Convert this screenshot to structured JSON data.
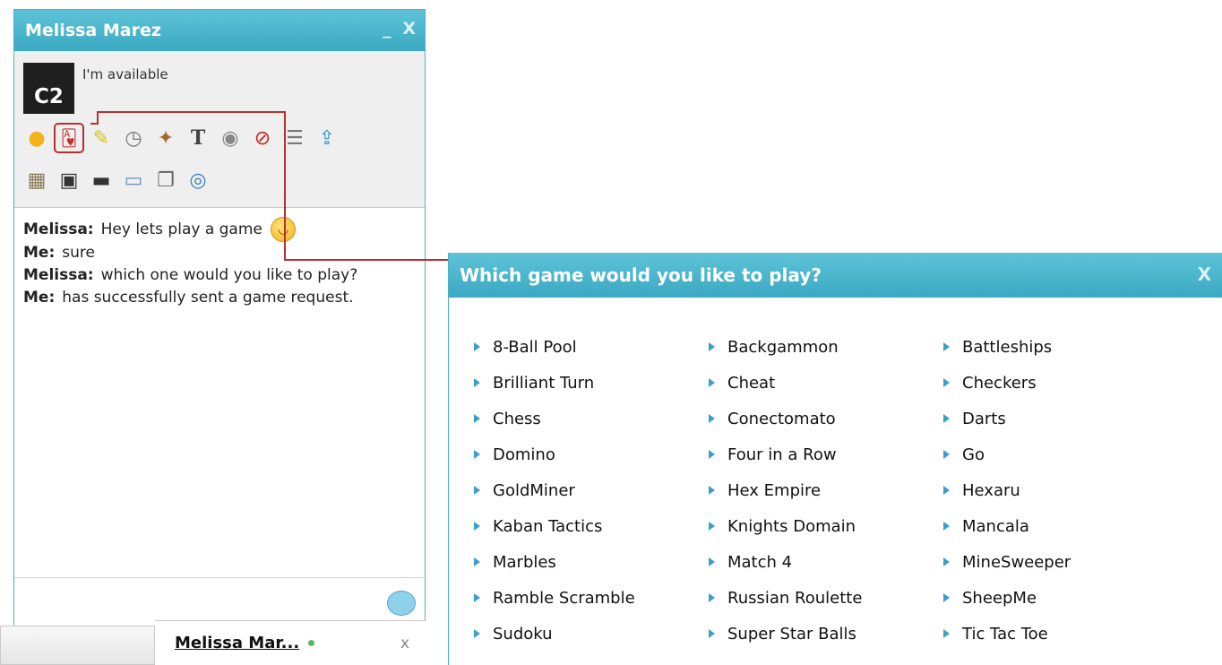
{
  "chat": {
    "title": "Melissa Marez",
    "minimize": "_",
    "close": "X",
    "avatar_text": "C2",
    "status": "I'm available",
    "toolbar_row1": [
      "emoticon-icon",
      "games-cards-icon",
      "pencil-icon",
      "clock-icon",
      "broom-icon",
      "text-format-icon",
      "webcam-icon",
      "block-icon",
      "list-icon",
      "upload-icon"
    ],
    "toolbar_row2": [
      "firewall-icon",
      "save-icon",
      "monitor-icon",
      "edit-note-icon",
      "copy-icon",
      "search-webcam-icon"
    ],
    "messages": [
      {
        "who": "Melissa:",
        "text": "Hey lets play a game"
      },
      {
        "who": "Me:",
        "text": "sure"
      },
      {
        "who": "Melissa:",
        "text": "which one would you like to play?"
      },
      {
        "who": "Me:",
        "text": "has successfully sent a game request."
      }
    ]
  },
  "taskbar": {
    "tab_name": "Melissa Mar...",
    "tab_close": "x"
  },
  "dialog": {
    "title": "Which game would you like to play?",
    "close": "X",
    "games": [
      "8-Ball Pool",
      "Backgammon",
      "Battleships",
      "Brilliant Turn",
      "Cheat",
      "Checkers",
      "Chess",
      "Conectomato",
      "Darts",
      "Domino",
      "Four in a Row",
      "Go",
      "GoldMiner",
      "Hex Empire",
      "Hexaru",
      "Kaban Tactics",
      "Knights Domain",
      "Mancala",
      "Marbles",
      "Match 4",
      "MineSweeper",
      "Ramble Scramble",
      "Russian Roulette",
      "SheepMe",
      "Sudoku",
      "Super Star Balls",
      "Tic Tac Toe"
    ]
  },
  "colors": {
    "title_bar": "#3aa9c2",
    "highlight_outline": "#b83030",
    "arrow": "#3a9fca"
  }
}
